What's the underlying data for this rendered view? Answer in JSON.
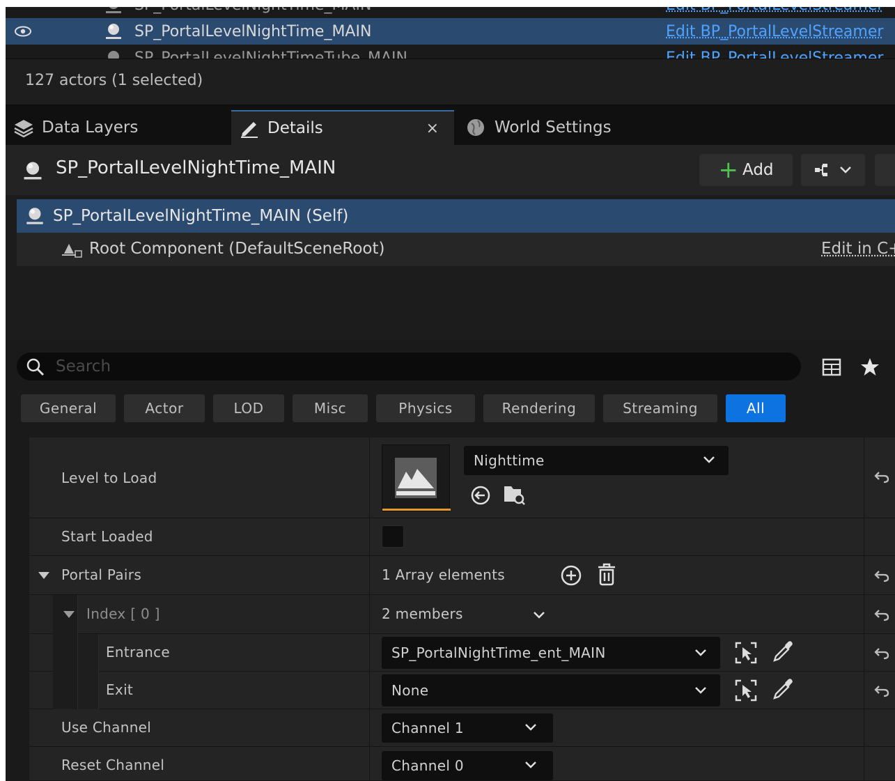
{
  "outliner": {
    "rows": [
      {
        "name": "SP_PortalLevelNightTime_MAIN",
        "edit": "Edit BP_PortalLevelStreamer"
      },
      {
        "name": "SP_PortalLevelNightTime_MAIN",
        "edit": "Edit BP_PortalLevelStreamer"
      },
      {
        "name": "SP_PortalLevelNightTimeTube_MAIN",
        "edit": "Edit BP_PortalLevelStreamer"
      }
    ],
    "count": "127 actors (1 selected)"
  },
  "tabs": [
    {
      "label": "Data Layers"
    },
    {
      "label": "Details",
      "close": "×"
    },
    {
      "label": "World Settings"
    }
  ],
  "header": {
    "title": "SP_PortalLevelNightTime_MAIN",
    "add_label": "Add"
  },
  "components": {
    "self": "SP_PortalLevelNightTime_MAIN (Self)",
    "root": "Root Component (DefaultSceneRoot)",
    "edit_cpp": "Edit in C++"
  },
  "search": {
    "placeholder": "Search"
  },
  "filters": [
    "General",
    "Actor",
    "LOD",
    "Misc",
    "Physics",
    "Rendering",
    "Streaming",
    "All"
  ],
  "properties": {
    "level_to_load": {
      "label": "Level to Load",
      "value": "Nighttime"
    },
    "start_loaded": {
      "label": "Start Loaded"
    },
    "portal_pairs": {
      "label": "Portal Pairs",
      "value": "1 Array elements"
    },
    "index": {
      "label": "Index [ 0 ]",
      "value": "2 members"
    },
    "entrance": {
      "label": "Entrance",
      "value": "SP_PortalNightTime_ent_MAIN"
    },
    "exit": {
      "label": "Exit",
      "value": "None"
    },
    "use_channel": {
      "label": "Use Channel",
      "value": "Channel 1"
    },
    "reset_channel": {
      "label": "Reset Channel",
      "value": "Channel 0"
    }
  },
  "colors": {
    "selection": "#2b4a70",
    "accent": "#0d73e0",
    "link": "#4fa3ff",
    "add_plus": "#4ec24e",
    "thumb_bar": "#e39a22"
  }
}
